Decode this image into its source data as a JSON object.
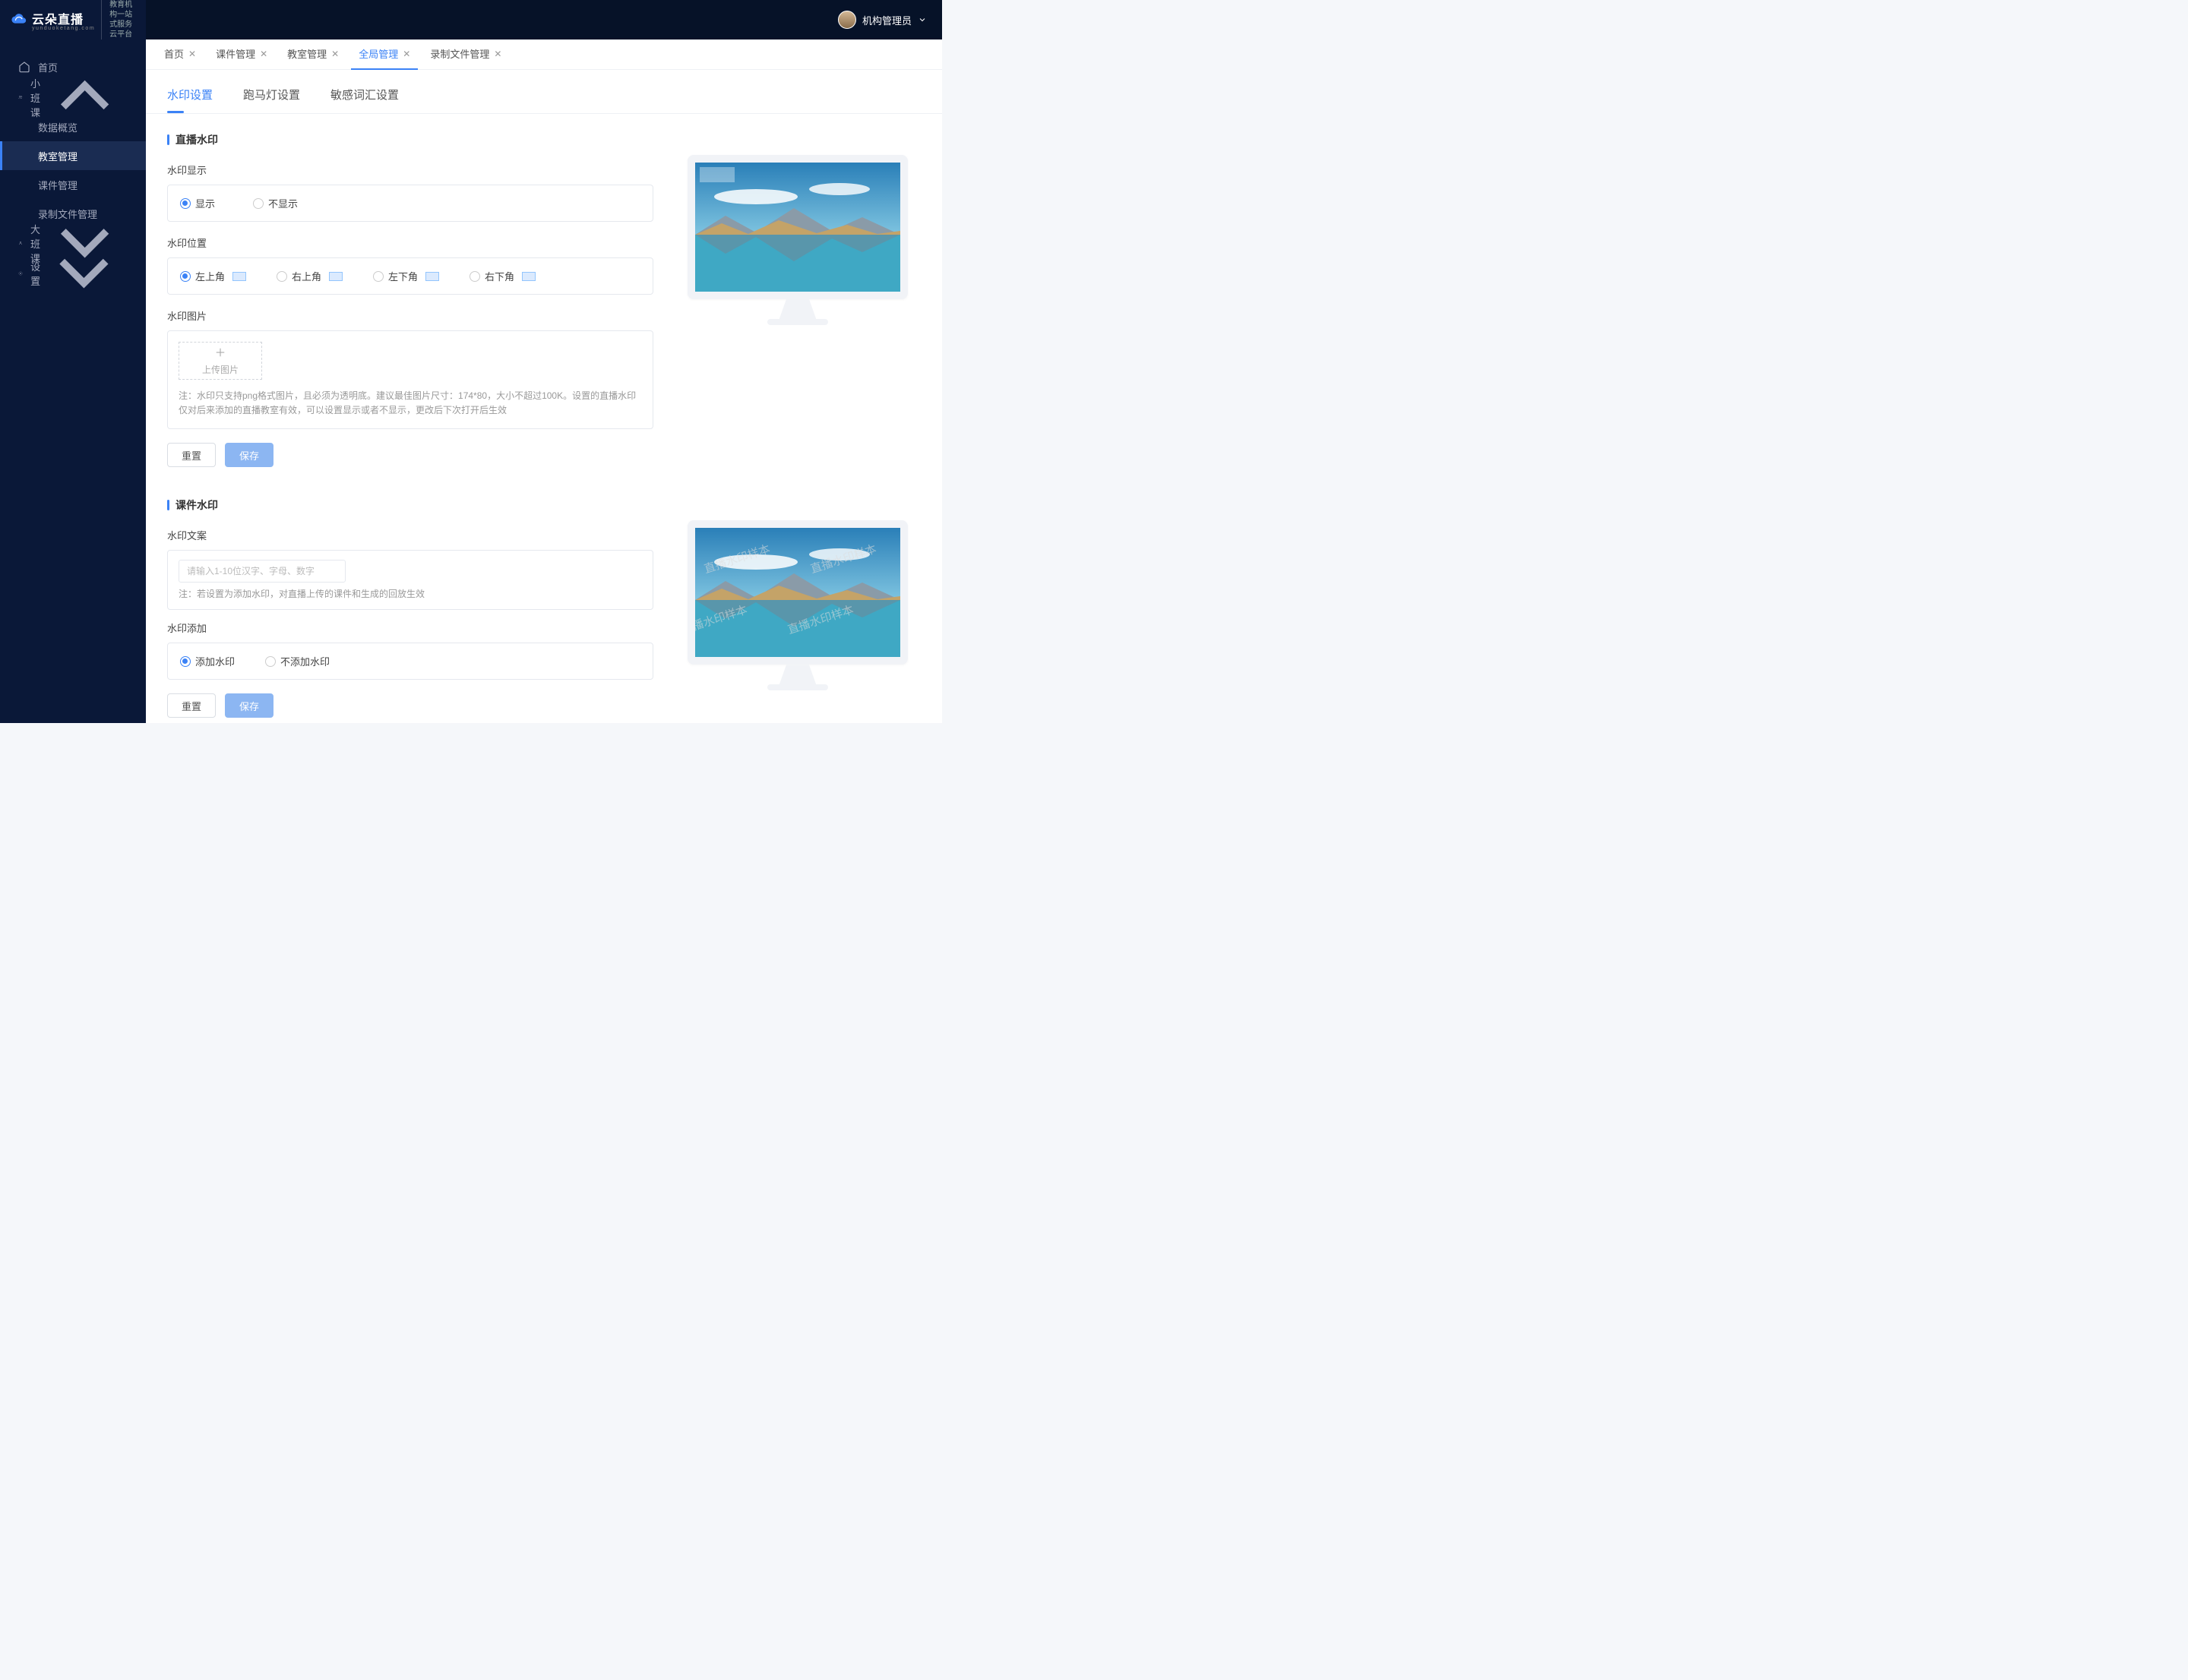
{
  "brand": {
    "name": "云朵直播",
    "sub": "yunduoketang.com",
    "desc1": "教育机构一站",
    "desc2": "式服务云平台"
  },
  "user": {
    "name": "机构管理员"
  },
  "sidebar": {
    "home": "首页",
    "small_class": "小班课",
    "sub": {
      "data_overview": "数据概览",
      "classroom_mgmt": "教室管理",
      "courseware_mgmt": "课件管理",
      "recording_mgmt": "录制文件管理"
    },
    "big_class": "大班课",
    "settings": "设置"
  },
  "page_tabs": {
    "home": "首页",
    "courseware": "课件管理",
    "classroom": "教室管理",
    "global": "全局管理",
    "recording": "录制文件管理"
  },
  "inner_tabs": {
    "watermark": "水印设置",
    "marquee": "跑马灯设置",
    "sensitive": "敏感词汇设置"
  },
  "section1": {
    "title": "直播水印",
    "display_label": "水印显示",
    "display_show": "显示",
    "display_hide": "不显示",
    "position_label": "水印位置",
    "pos_tl": "左上角",
    "pos_tr": "右上角",
    "pos_bl": "左下角",
    "pos_br": "右下角",
    "image_label": "水印图片",
    "upload_text": "上传图片",
    "note": "注：水印只支持png格式图片，且必须为透明底。建议最佳图片尺寸：174*80，大小不超过100K。设置的直播水印仅对后来添加的直播教室有效，可以设置显示或者不显示，更改后下次打开后生效",
    "reset": "重置",
    "save": "保存"
  },
  "section2": {
    "title": "课件水印",
    "text_label": "水印文案",
    "text_placeholder": "请输入1-10位汉字、字母、数字",
    "note": "注：若设置为添加水印，对直播上传的课件和生成的回放生效",
    "add_label": "水印添加",
    "add_yes": "添加水印",
    "add_no": "不添加水印",
    "reset": "重置",
    "save": "保存",
    "sample_text": "直播水印样本"
  }
}
